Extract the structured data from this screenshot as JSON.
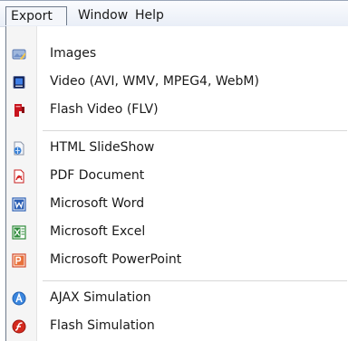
{
  "menubar": {
    "items": [
      {
        "label": "Export"
      },
      {
        "label": "Window"
      },
      {
        "label": "Help"
      }
    ]
  },
  "dropdown": {
    "groups": [
      [
        {
          "label": "Images",
          "icon": "images-icon"
        },
        {
          "label": "Video (AVI, WMV, MPEG4, WebM)",
          "icon": "video-icon"
        },
        {
          "label": "Flash Video (FLV)",
          "icon": "flash-video-icon"
        }
      ],
      [
        {
          "label": "HTML SlideShow",
          "icon": "html-slideshow-icon"
        },
        {
          "label": "PDF Document",
          "icon": "pdf-icon"
        },
        {
          "label": "Microsoft Word",
          "icon": "word-icon"
        },
        {
          "label": "Microsoft Excel",
          "icon": "excel-icon"
        },
        {
          "label": "Microsoft PowerPoint",
          "icon": "powerpoint-icon"
        }
      ],
      [
        {
          "label": "AJAX Simulation",
          "icon": "ajax-icon"
        },
        {
          "label": "Flash Simulation",
          "icon": "flash-simulation-icon"
        }
      ]
    ]
  }
}
